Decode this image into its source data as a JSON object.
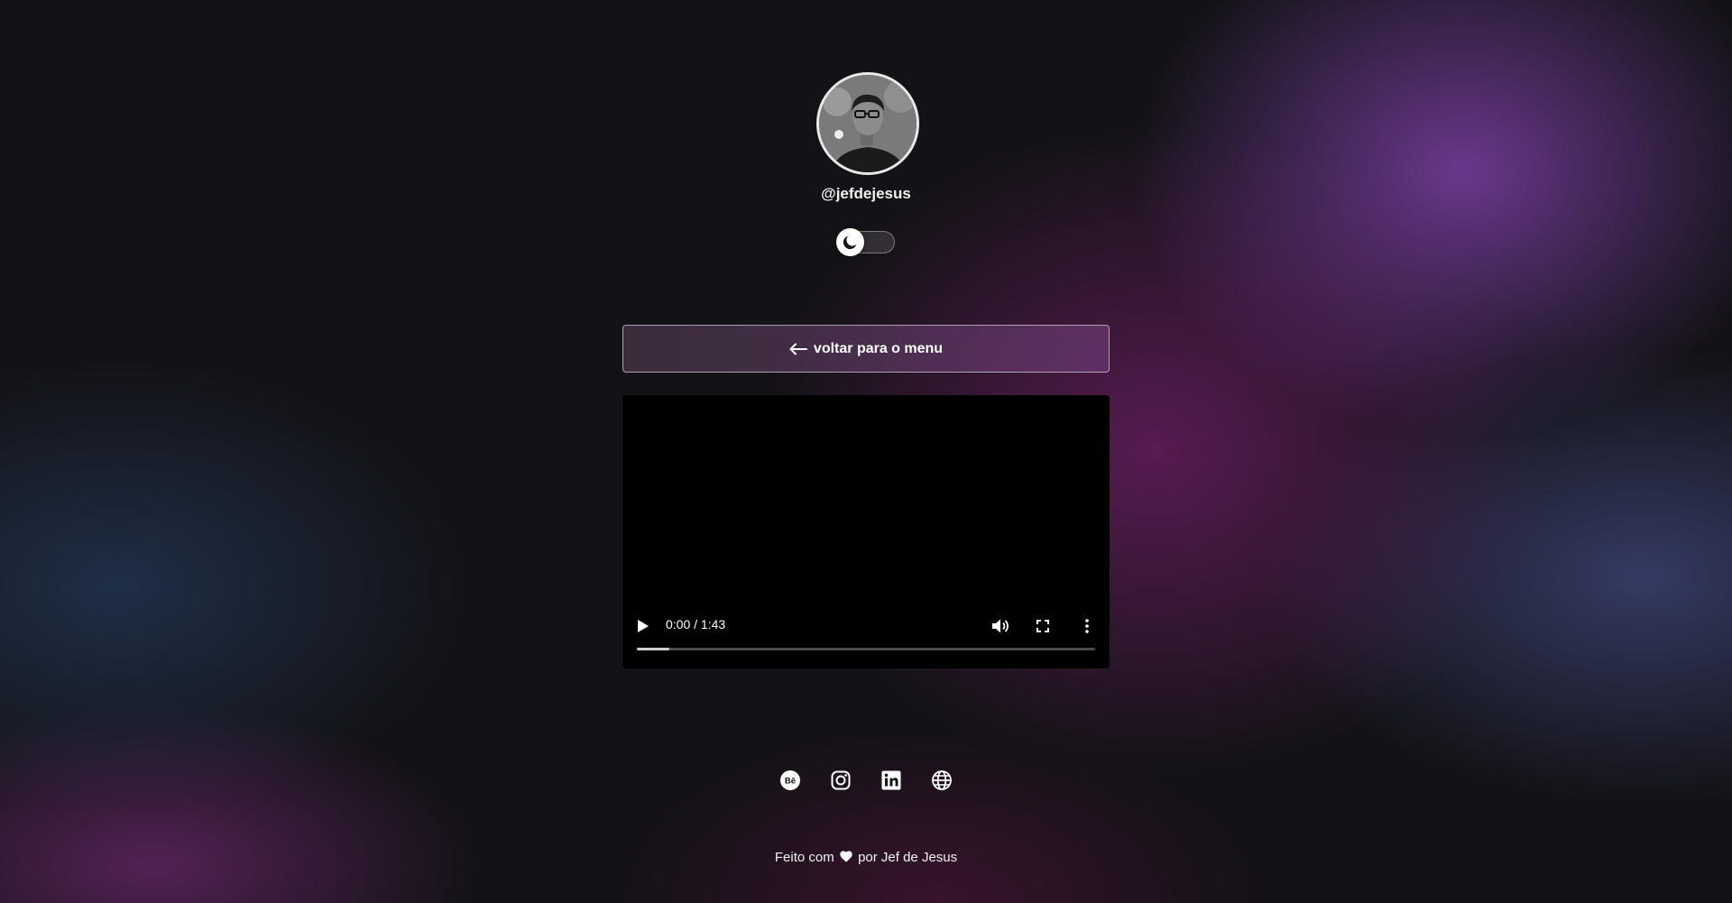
{
  "profile": {
    "username": "@jefdejesus"
  },
  "theme_toggle": {
    "icon": "moon-icon",
    "state": "dark"
  },
  "back_button": {
    "label": "voltar para o menu",
    "icon": "arrow-left-icon"
  },
  "video": {
    "time": "0:00 / 1:43",
    "progress": 0.07,
    "controls": [
      "play-icon",
      "volume-icon",
      "fullscreen-icon",
      "more-options-icon"
    ]
  },
  "social": [
    "behance-icon",
    "instagram-icon",
    "linkedin-icon",
    "globe-icon"
  ],
  "footer": {
    "before": "Feito com",
    "after": "por Jef de Jesus",
    "icon": "heart-icon"
  }
}
